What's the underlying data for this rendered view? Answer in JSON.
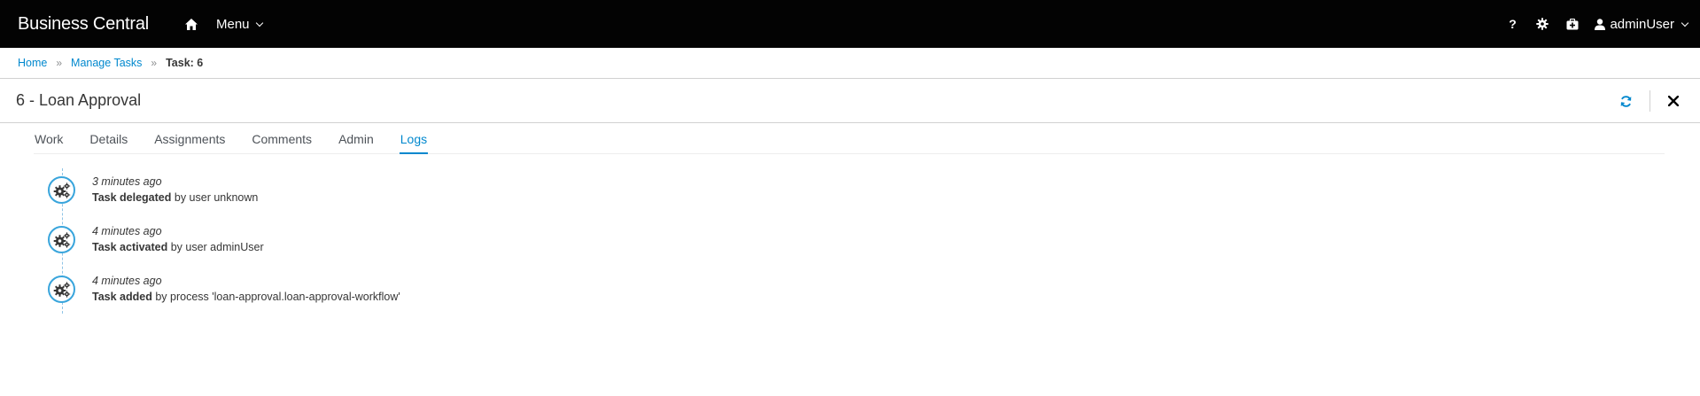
{
  "navbar": {
    "brand": "Business Central",
    "menu_label": "Menu",
    "help_label": "?",
    "user_label": "adminUser"
  },
  "breadcrumb": {
    "home": "Home",
    "sep1": "»",
    "manage_tasks": "Manage Tasks",
    "sep2": "»",
    "current": "Task: 6"
  },
  "title": "6 - Loan Approval",
  "tabs": [
    {
      "label": "Work"
    },
    {
      "label": "Details"
    },
    {
      "label": "Assignments"
    },
    {
      "label": "Comments"
    },
    {
      "label": "Admin"
    },
    {
      "label": "Logs"
    }
  ],
  "active_tab": "Logs",
  "logs": [
    {
      "time": "3 minutes ago",
      "action": "Task delegated",
      "detail": " by user unknown",
      "icon": "cogs-icon"
    },
    {
      "time": "4 minutes ago",
      "action": "Task activated",
      "detail": " by user adminUser",
      "icon": "cogs-icon"
    },
    {
      "time": "4 minutes ago",
      "action": "Task added",
      "detail": " by process 'loan-approval.loan-approval-workflow'",
      "icon": "cogs-icon"
    }
  ],
  "colors": {
    "navbar_bg": "#030303",
    "accent": "#0088ce",
    "timeline_ring": "#39a5dc"
  }
}
